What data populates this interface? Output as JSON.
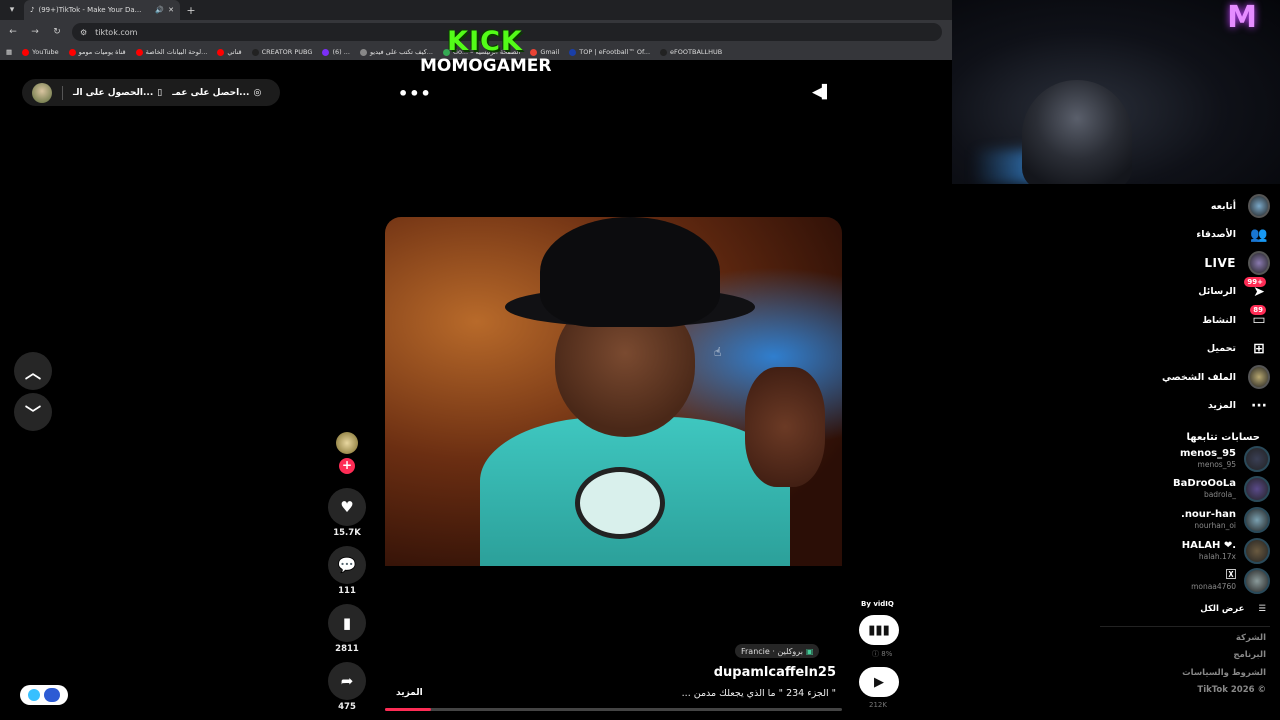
{
  "browser": {
    "tab_title": "(99+)TikTok - Make Your Da...",
    "url": "tiktok.com",
    "bookmarks": [
      {
        "label": "YouTube",
        "color": "#ff0000"
      },
      {
        "label": "قناة يوميات مومو",
        "color": "#ff0000"
      },
      {
        "label": "لوحة البيانات الخاصة...",
        "color": "#ff0000"
      },
      {
        "label": "قناتي",
        "color": "#ff0000"
      },
      {
        "label": "CREATOR PUBG",
        "color": "#222222"
      },
      {
        "label": "(6) ...",
        "color": "#7b2ff7"
      },
      {
        "label": "كيف تكتب على فيديو...",
        "color": "#888888"
      },
      {
        "label": "Go... – الصفحة الرئيسية",
        "color": "#34a853"
      },
      {
        "label": "Gmail",
        "color": "#ea4335"
      },
      {
        "label": "TOP | eFootball™ Of...",
        "color": "#1a3fa8"
      },
      {
        "label": "eFOOTBALLHUB",
        "color": "#222222"
      }
    ]
  },
  "overlay": {
    "kick_logo": "KICK",
    "streamer_name": "MOMOGAMER"
  },
  "top_cluster": {
    "item1": "احصل على عمـ...",
    "item2": "الحصول على الـ..."
  },
  "video": {
    "likes": "15.7K",
    "comments": "111",
    "saves": "2811",
    "shares": "475",
    "progress_fraction": 0.1,
    "location_tag": "Francie · بروكلين",
    "username": "dupamlcaffeln25",
    "description": "\" الجزء 234 \" ما الذي يجعلك مدمن ...",
    "more_label": "المزيد"
  },
  "vidiq": {
    "by_label": "By vidIQ",
    "percent": "8%",
    "views": "212K"
  },
  "sidebar": {
    "nav": [
      {
        "label": "أتابعه",
        "icon": "following-avatar-icon"
      },
      {
        "label": "الأصدقاء",
        "icon": "friends-icon"
      },
      {
        "label": "LIVE",
        "icon": "live-avatar-icon"
      },
      {
        "label": "الرسائل",
        "icon": "messages-icon",
        "badge": "99+"
      },
      {
        "label": "النشاط",
        "icon": "activity-icon",
        "badge": "89"
      },
      {
        "label": "تحميل",
        "icon": "upload-icon"
      },
      {
        "label": "الملف الشخصي",
        "icon": "profile-avatar-icon"
      },
      {
        "label": "المزيد",
        "icon": "more-dots-icon"
      }
    ],
    "following_heading": "حسابات تتابعها",
    "following": [
      {
        "name": "menos_95",
        "handle": "menos_95",
        "color": "#3a3f55"
      },
      {
        "name": "BaDroOoLa",
        "handle": "badrola_",
        "color": "#5a4a8a"
      },
      {
        "name": ".nour-han",
        "handle": "nourhan_oi",
        "color": "#7aa0b0"
      },
      {
        "name": "HALAH ❤.",
        "handle": "halah.17x",
        "color": "#6a5a40"
      },
      {
        "name": "🅇",
        "handle": "monaa4760",
        "color": "#8a9a9a"
      }
    ],
    "see_all": "عرض الكل",
    "footer": [
      "الشركة",
      "البرنامج",
      "الشروط والسياسات",
      "TikTok 2026 ©"
    ]
  },
  "colors": {
    "accent": "#fe2c55",
    "kick_green": "#53fc18"
  }
}
